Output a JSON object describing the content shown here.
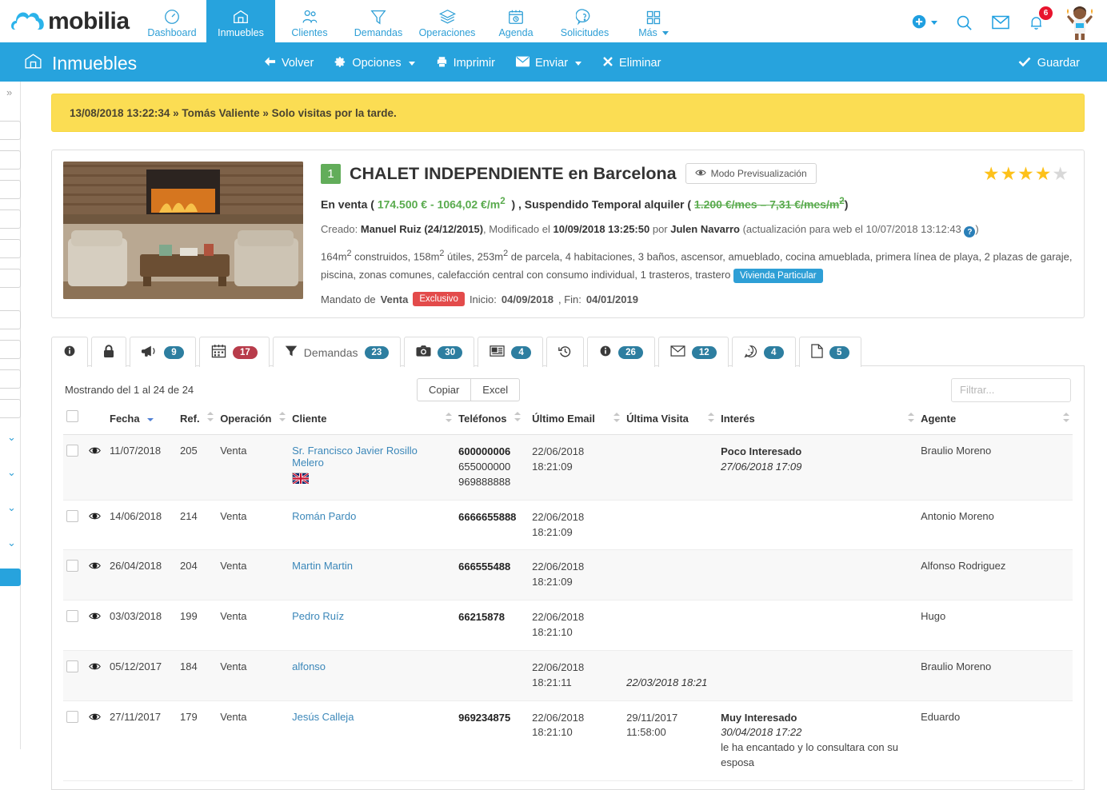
{
  "brand": {
    "name": "mobilia"
  },
  "topnav": {
    "items": [
      {
        "label": "Dashboard",
        "icon": "speedometer-icon",
        "active": false
      },
      {
        "label": "Inmuebles",
        "icon": "house-icon",
        "active": true
      },
      {
        "label": "Clientes",
        "icon": "people-icon",
        "active": false
      },
      {
        "label": "Demandas",
        "icon": "funnel-icon",
        "active": false
      },
      {
        "label": "Operaciones",
        "icon": "layers-icon",
        "active": false
      },
      {
        "label": "Agenda",
        "icon": "calendar-clock-icon",
        "active": false
      },
      {
        "label": "Solicitudes",
        "icon": "question-bubble-icon",
        "active": false
      },
      {
        "label": "Más",
        "icon": "grid-icon",
        "active": false
      }
    ],
    "right": {
      "add_icon": "plus-circle-icon",
      "search_icon": "search-icon",
      "mail_icon": "envelope-icon",
      "bell_icon": "bell-icon",
      "notifications_count": "6",
      "avatar": "user-avatar"
    }
  },
  "subbar": {
    "title": "Inmuebles",
    "title_icon": "house-icon",
    "actions": [
      {
        "label": "Volver",
        "icon": "arrow-left-icon",
        "caret": false
      },
      {
        "label": "Opciones",
        "icon": "gear-icon",
        "caret": true
      },
      {
        "label": "Imprimir",
        "icon": "printer-icon",
        "caret": false
      },
      {
        "label": "Enviar",
        "icon": "envelope-icon",
        "caret": true
      },
      {
        "label": "Eliminar",
        "icon": "x-icon",
        "caret": false
      }
    ],
    "save_label": "Guardar",
    "save_icon": "check-icon"
  },
  "notice": {
    "text": "13/08/2018 13:22:34 » Tomás Valiente » Solo visitas por la tarde."
  },
  "property": {
    "number_badge": "1",
    "title": "CHALET INDEPENDIENTE en Barcelona",
    "preview_button": "Modo Previsualización",
    "preview_icon": "eye-icon",
    "rating": 4,
    "rating_max": 5,
    "sale_label": "En venta",
    "sale_price": "174.500 €",
    "sale_unit_price": "1064,02 €/m",
    "sale_unit_exp": "2",
    "rent_label": "Suspendido Temporal alquiler",
    "rent_price": "1.200 €/mes",
    "rent_unit_price": "7,31 €/mes/m",
    "rent_unit_exp": "2",
    "created_label": "Creado:",
    "created_by": "Manuel Ruiz (24/12/2015)",
    "modified_label": ", Modificado el",
    "modified_date": "10/09/2018 13:25:50",
    "modified_by_label": "por",
    "modified_by": "Julen Navarro",
    "web_update": "(actualización para web el 10/07/2018 13:12:43",
    "help_icon": "question-mark-icon",
    "features_1": "164m",
    "features_1_exp": "2",
    "features_rest": " construidos, 158m",
    "features_2_exp": "2",
    "features_rest2": " útiles, 253m",
    "features_3_exp": "2",
    "features_rest3": " de parcela, 4 habitaciones, 3 baños, ascensor, amueblado, cocina amueblada, primera línea de playa, 2 plazas de garaje,",
    "features_line2": "piscina, zonas comunes, calefacción central con consumo individual, 1 trasteros, trastero",
    "tag_vivienda": "Vivienda Particular",
    "mandato_label": "Mandato de",
    "mandato_type": "Venta",
    "tag_exclusivo": "Exclusivo",
    "inicio_label": "Inicio:",
    "inicio_date": "04/09/2018",
    "fin_label": ", Fin:",
    "fin_date": "04/01/2019"
  },
  "tabs": [
    {
      "icon": "info-circle-icon",
      "label": "",
      "count": "",
      "active": false
    },
    {
      "icon": "lock-icon",
      "label": "",
      "count": "",
      "active": false
    },
    {
      "icon": "megaphone-icon",
      "label": "",
      "count": "9",
      "active": false,
      "pill": "blue"
    },
    {
      "icon": "calendar-icon",
      "label": "",
      "count": "17",
      "active": false,
      "pill": "red"
    },
    {
      "icon": "funnel-icon",
      "label": "Demandas",
      "count": "23",
      "active": true,
      "pill": "blue"
    },
    {
      "icon": "camera-icon",
      "label": "",
      "count": "30",
      "active": false,
      "pill": "blue"
    },
    {
      "icon": "newspaper-icon",
      "label": "",
      "count": "4",
      "active": false,
      "pill": "blue"
    },
    {
      "icon": "history-icon",
      "label": "",
      "count": "",
      "active": false
    },
    {
      "icon": "info-circle-filled-icon",
      "label": "",
      "count": "26",
      "active": false,
      "pill": "blue"
    },
    {
      "icon": "envelope-icon",
      "label": "",
      "count": "12",
      "active": false,
      "pill": "blue"
    },
    {
      "icon": "whatsapp-icon",
      "label": "",
      "count": "4",
      "active": false,
      "pill": "blue"
    },
    {
      "icon": "document-icon",
      "label": "",
      "count": "5",
      "active": false,
      "pill": "blue"
    }
  ],
  "table": {
    "showing": "Mostrando del 1 al 24 de 24",
    "copy_label": "Copiar",
    "excel_label": "Excel",
    "filter_placeholder": "Filtrar...",
    "filter_value": "",
    "columns": [
      "Fecha",
      "Ref.",
      "Operación",
      "Cliente",
      "Teléfonos",
      "Último Email",
      "Última Visita",
      "Interés",
      "Agente"
    ],
    "rows": [
      {
        "fecha": "11/07/2018",
        "ref": "205",
        "operacion": "Venta",
        "cliente": "Sr. Francisco Javier Rosillo Melero",
        "flag": "uk-flag-icon",
        "telefonos": [
          "600000006",
          "655000000",
          "969888888"
        ],
        "telefonos_bold": [
          true,
          false,
          false
        ],
        "ultimo_email": [
          "22/06/2018",
          "18:21:09"
        ],
        "ultima_visita": [],
        "interes_titulo": "Poco Interesado",
        "interes_fecha": "27/06/2018 17:09",
        "interes_nota": "",
        "agente": "Braulio Moreno"
      },
      {
        "fecha": "14/06/2018",
        "ref": "214",
        "operacion": "Venta",
        "cliente": "Román Pardo",
        "flag": "",
        "telefonos": [
          "6666655888"
        ],
        "telefonos_bold": [
          true
        ],
        "ultimo_email": [
          "22/06/2018",
          "18:21:09"
        ],
        "ultima_visita": [],
        "interes_titulo": "",
        "interes_fecha": "",
        "interes_nota": "",
        "agente": "Antonio Moreno"
      },
      {
        "fecha": "26/04/2018",
        "ref": "204",
        "operacion": "Venta",
        "cliente": "Martin Martin",
        "flag": "",
        "telefonos": [
          "666555488"
        ],
        "telefonos_bold": [
          true
        ],
        "ultimo_email": [
          "22/06/2018",
          "18:21:09"
        ],
        "ultima_visita": [],
        "interes_titulo": "",
        "interes_fecha": "",
        "interes_nota": "",
        "agente": "Alfonso Rodriguez"
      },
      {
        "fecha": "03/03/2018",
        "ref": "199",
        "operacion": "Venta",
        "cliente": "Pedro Ruíz",
        "flag": "",
        "telefonos": [
          "66215878"
        ],
        "telefonos_bold": [
          true
        ],
        "ultimo_email": [
          "22/06/2018",
          "18:21:10"
        ],
        "ultima_visita": [],
        "interes_titulo": "",
        "interes_fecha": "",
        "interes_nota": "",
        "agente": "Hugo"
      },
      {
        "fecha": "05/12/2017",
        "ref": "184",
        "operacion": "Venta",
        "cliente": "alfonso",
        "flag": "",
        "telefonos": [],
        "telefonos_bold": [],
        "ultimo_email": [
          "22/06/2018",
          "18:21:11"
        ],
        "ultima_visita": [
          "",
          "22/03/2018 18:21"
        ],
        "interes_titulo": "",
        "interes_fecha": "",
        "interes_nota": "",
        "agente": "Braulio Moreno"
      },
      {
        "fecha": "27/11/2017",
        "ref": "179",
        "operacion": "Venta",
        "cliente": "Jesús Calleja",
        "flag": "",
        "telefonos": [
          "969234875"
        ],
        "telefonos_bold": [
          true
        ],
        "ultimo_email": [
          "22/06/2018",
          "18:21:10"
        ],
        "ultima_visita": [
          "29/11/2017",
          "11:58:00"
        ],
        "interes_titulo": "Muy Interesado",
        "interes_fecha": "30/04/2018 17:22",
        "interes_nota": "le ha encantado y lo consultara con su esposa",
        "agente": "Eduardo"
      }
    ]
  },
  "colors": {
    "brand_blue": "#27a3dd",
    "accent_green": "#5aab4e",
    "badge_red": "#e8142d",
    "pill_blue": "#2d7ea0",
    "pill_red": "#b83c4b",
    "notice_yellow": "#fbdd53",
    "star_gold": "#fdc11a"
  }
}
